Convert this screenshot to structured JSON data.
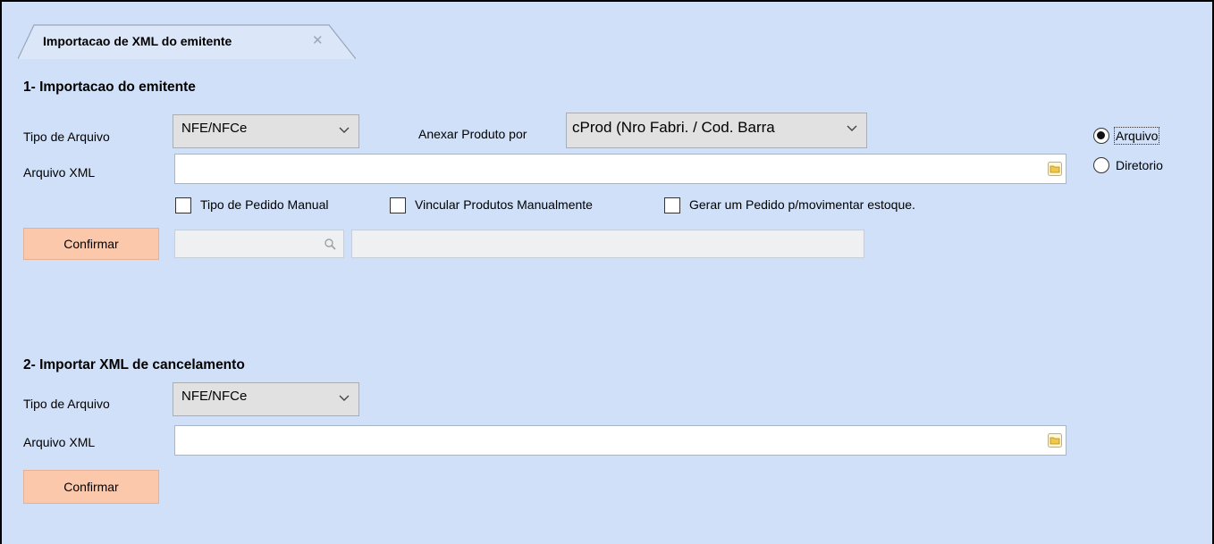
{
  "tab": {
    "title": "Importacao de XML do emitente",
    "close_glyph": "✕"
  },
  "section1": {
    "title": "1- Importacao do emitente",
    "tipo_arquivo_label": "Tipo de Arquivo",
    "tipo_arquivo_value": "NFE/NFCe",
    "anexar_label": "Anexar Produto por",
    "anexar_value": "cProd (Nro Fabri. / Cod. Barra",
    "arquivo_xml_label": "Arquivo XML",
    "arquivo_xml_value": "",
    "checkboxes": [
      {
        "label": "Tipo de Pedido Manual",
        "checked": false
      },
      {
        "label": "Vincular Produtos Manualmente",
        "checked": false
      },
      {
        "label": "Gerar um Pedido p/movimentar estoque.",
        "checked": false
      }
    ],
    "confirm_label": "Confirmar",
    "radio_options": [
      {
        "label": "Arquivo",
        "selected": true
      },
      {
        "label": "Diretorio",
        "selected": false
      }
    ]
  },
  "section2": {
    "title": "2- Importar XML de cancelamento",
    "tipo_arquivo_label": "Tipo de Arquivo",
    "tipo_arquivo_value": "NFE/NFCe",
    "arquivo_xml_label": "Arquivo XML",
    "arquivo_xml_value": "",
    "confirm_label": "Confirmar"
  },
  "icons": {
    "dropdown": "chevron-down-icon",
    "folder": "folder-icon",
    "search": "search-icon",
    "close": "close-icon"
  },
  "colors": {
    "background": "#cfe0f8",
    "confirm_button": "#fcc8ac",
    "folder_icon": "#f3c84a"
  }
}
